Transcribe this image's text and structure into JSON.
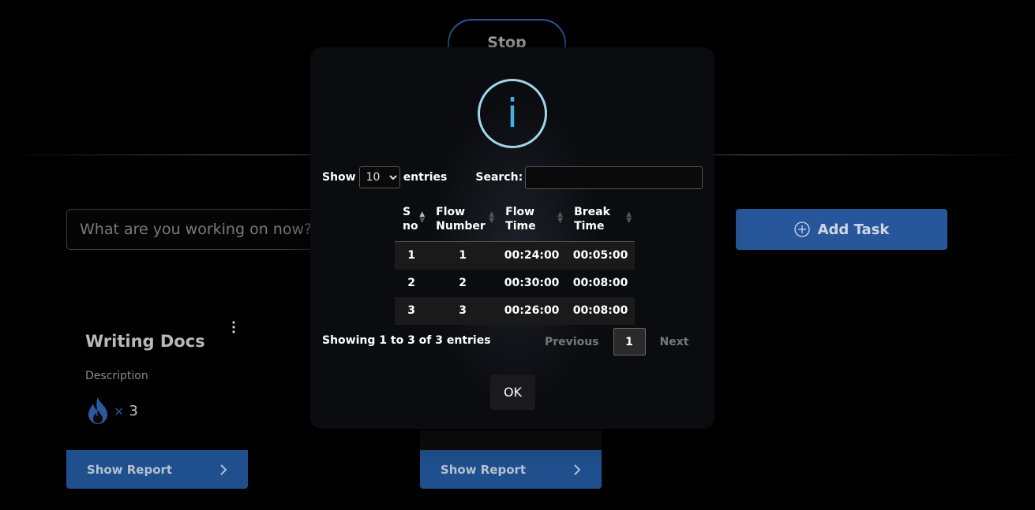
{
  "header": {
    "stop_label": "Stop"
  },
  "task_input": {
    "placeholder": "What are you working on now?"
  },
  "add_task": {
    "label": "Add Task"
  },
  "cards": [
    {
      "title": "Writing Docs",
      "description": "Description",
      "times": "×",
      "count": "3",
      "report_label": "Show Report"
    },
    {
      "report_label": "Show Report"
    }
  ],
  "modal": {
    "icon_letter": "i",
    "show_label": "Show",
    "entries_label": "entries",
    "page_size": "10",
    "page_size_options": [
      "10"
    ],
    "search_label": "Search:",
    "search_value": "",
    "columns": [
      {
        "line1": "S",
        "line2": "no"
      },
      {
        "line1": "Flow",
        "line2": "Number"
      },
      {
        "line1": "Flow",
        "line2": "Time"
      },
      {
        "line1": "Break",
        "line2": "Time"
      }
    ],
    "rows": [
      {
        "sno": "1",
        "flow_number": "1",
        "flow_time": "00:24:00",
        "break_time": "00:05:00"
      },
      {
        "sno": "2",
        "flow_number": "2",
        "flow_time": "00:30:00",
        "break_time": "00:08:00"
      },
      {
        "sno": "3",
        "flow_number": "3",
        "flow_time": "00:26:00",
        "break_time": "00:08:00"
      }
    ],
    "info": "Showing 1 to 3 of 3 entries",
    "previous_label": "Previous",
    "current_page": "1",
    "next_label": "Next",
    "ok_label": "OK"
  },
  "colors": {
    "accent": "#27579a",
    "info_ring": "#9fd6ea",
    "info_letter": "#3fb1e3"
  }
}
